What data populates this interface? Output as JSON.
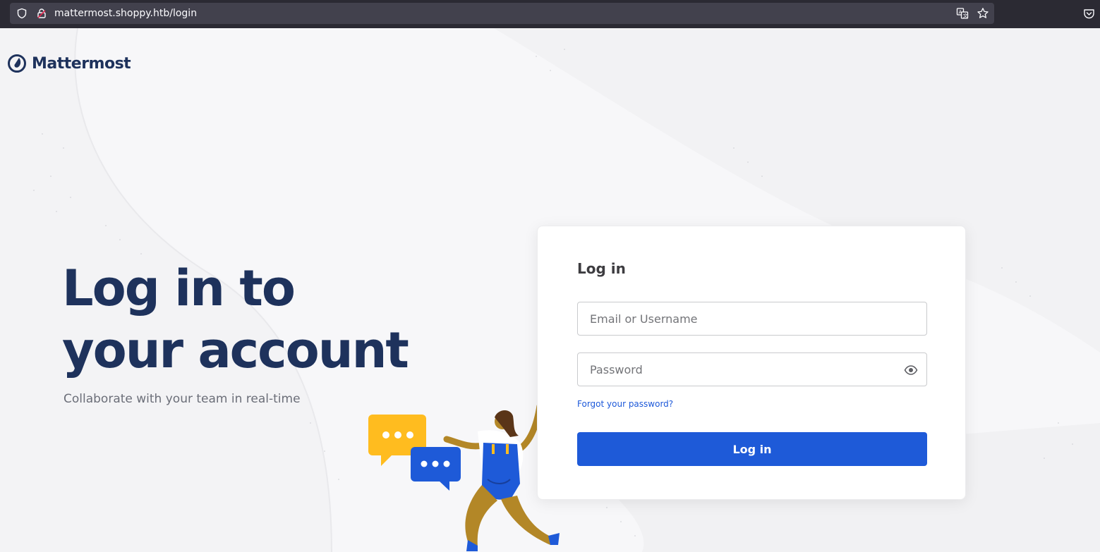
{
  "browser": {
    "url": "mattermost.shoppy.htb/login",
    "icons": [
      "shield-icon",
      "lock-icon",
      "translate-icon",
      "star-icon",
      "pocket-icon"
    ]
  },
  "brand": {
    "name": "Mattermost",
    "primary_color": "#1e325c",
    "accent_color": "#1e5ad8"
  },
  "hero": {
    "title_line1": "Log in to",
    "title_line2": "your account",
    "subtitle": "Collaborate with your team in real-time"
  },
  "login_form": {
    "title": "Log in",
    "email_placeholder": "Email or Username",
    "email_value": "",
    "password_placeholder": "Password",
    "password_value": "",
    "forgot_password": "Forgot your password?",
    "submit_label": "Log in"
  }
}
